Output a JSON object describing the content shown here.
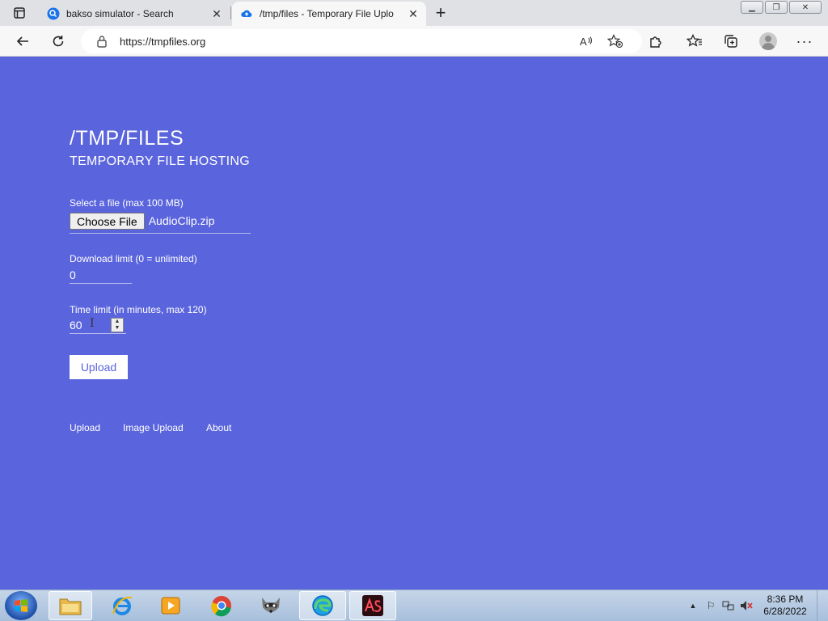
{
  "browser": {
    "tabs": [
      {
        "title": "bakso simulator - Search",
        "icon": "search-favicon",
        "active": false
      },
      {
        "title": "/tmp/files - Temporary File Uplo",
        "icon": "cloud-upload-favicon",
        "active": true
      }
    ],
    "address": "https://tmpfiles.org"
  },
  "page": {
    "title": "/TMP/FILES",
    "subtitle": "TEMPORARY FILE HOSTING",
    "file_label": "Select a file (max 100 MB)",
    "choose_button": "Choose File",
    "file_name": "AudioClip.zip",
    "download_label": "Download limit (0 = unlimited)",
    "download_value": "0",
    "time_label": "Time limit (in minutes, max 120)",
    "time_value": "60",
    "upload_button": "Upload",
    "nav": [
      "Upload",
      "Image Upload",
      "About"
    ]
  },
  "taskbar": {
    "apps": [
      "file-explorer",
      "internet-explorer",
      "media-player",
      "chrome",
      "raccoon-app",
      "edge",
      "adobe-animate"
    ],
    "time": "8:36 PM",
    "date": "6/28/2022"
  },
  "colors": {
    "page_bg": "#5a64dc"
  }
}
